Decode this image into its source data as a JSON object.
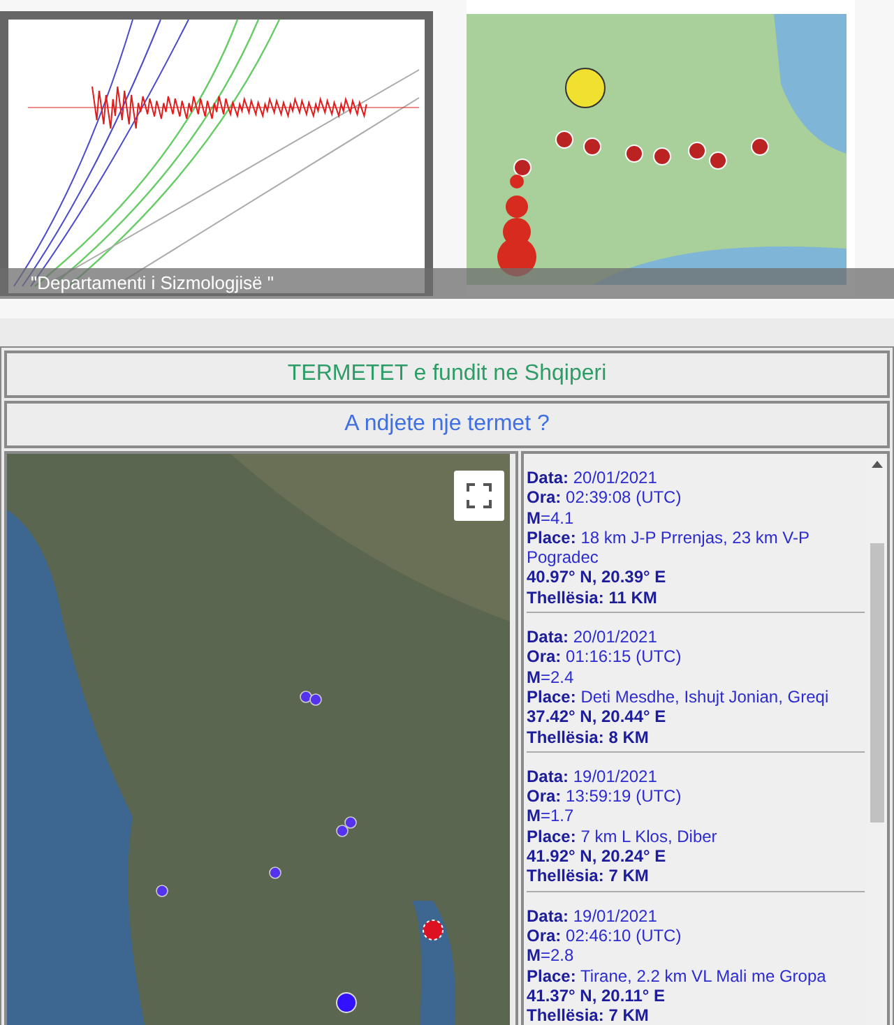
{
  "slideshow": {
    "caption": "\"Departamenti i Sizmologjisë \""
  },
  "header": {
    "title": "TERMETET e fundit ne Shqiperi",
    "subtitle": "A ndjete nje termet ?"
  },
  "events": [
    {
      "date": "**Data:** 20/01/2021",
      "time": "**Ora:** 02:39:08 (UTC)",
      "magnitude": "**M**=4.1",
      "place": "**Place:** 18 km J-P Prrenjas, 23 km V-P Pogradec",
      "coords": "40.97° N, 20.39° E",
      "depth": "Thellësia: 11 KM"
    },
    {
      "date": "**Data:** 20/01/2021",
      "time": "**Ora:** 01:16:15 (UTC)",
      "magnitude": "**M**=2.4",
      "place": "**Place:** Deti Mesdhe, Ishujt Jonian, Greqi",
      "coords": "37.42° N, 20.44° E",
      "depth": "Thellësia: 8 KM"
    },
    {
      "date": "**Data:** 19/01/2021",
      "time": "**Ora:** 13:59:19 (UTC)",
      "magnitude": "**M**=1.7",
      "place": "**Place:** 7 km L Klos, Diber",
      "coords": "41.92° N, 20.24° E",
      "depth": "Thellësia: 7 KM"
    },
    {
      "date": "**Data:** 19/01/2021",
      "time": "**Ora:** 02:46:10 (UTC)",
      "magnitude": "**M**=2.8",
      "place": "**Place:** Tirane, 2.2 km VL Mali me Gropa",
      "coords": "41.37° N, 20.11° E",
      "depth": "Thellësia: 7 KM"
    }
  ]
}
